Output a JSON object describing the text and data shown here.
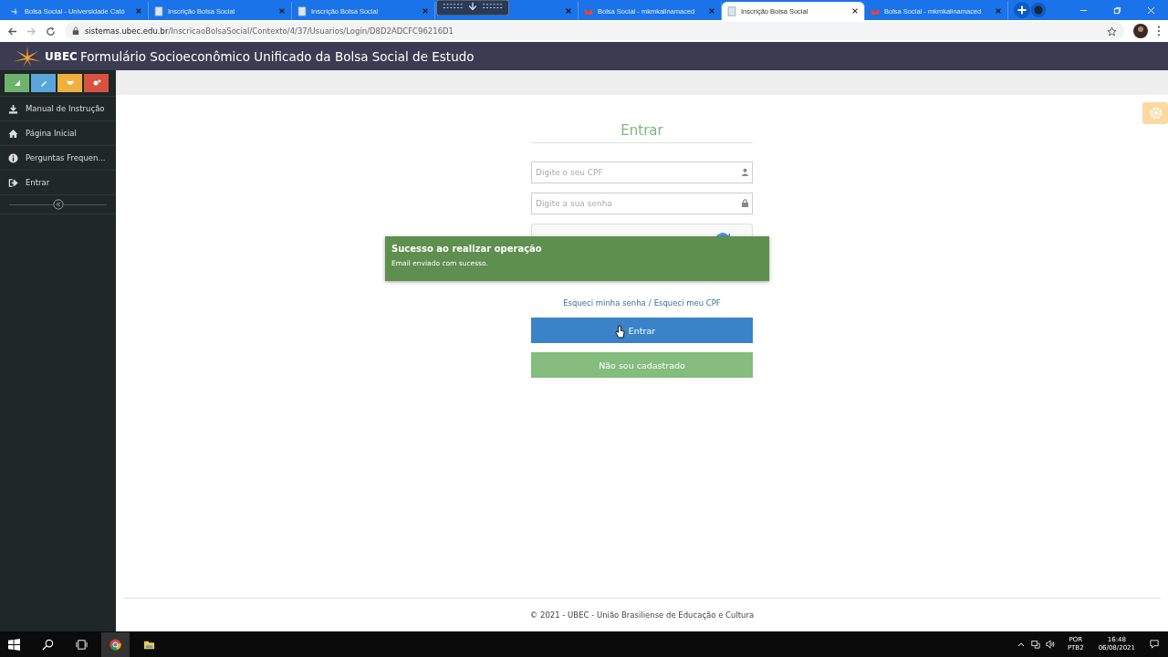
{
  "browser": {
    "tabs": [
      {
        "title": "Bolsa Social - Universidade Cató",
        "selected": false,
        "kind": "site"
      },
      {
        "title": "Inscrição Bolsa Social",
        "selected": false,
        "kind": "page"
      },
      {
        "title": "Inscrição Bolsa Social",
        "selected": false,
        "kind": "page"
      },
      {
        "kind": "hidden"
      },
      {
        "title": "Bolsa Social - mkmkalinamaced",
        "selected": false,
        "kind": "mail"
      },
      {
        "title": "Inscrição Bolsa Social",
        "selected": true,
        "kind": "page"
      },
      {
        "title": "Bolsa Social - mkmkalinamaced",
        "selected": false,
        "kind": "mail"
      }
    ],
    "url_host": "sistemas.ubec.edu.br",
    "url_path": "/InscricaoBolsaSocial/Contexto/4/37/Usuarios/Login/D8D2ADCFC96216D1"
  },
  "header": {
    "logo": "UBEC",
    "title": "Formulário Socioeconômico Unificado da Bolsa Social de Estudo"
  },
  "sidebar": {
    "shortcuts": [
      {
        "color": "#6db36d"
      },
      {
        "color": "#5aa6dc"
      },
      {
        "color": "#f0b040"
      },
      {
        "color": "#d8533f"
      }
    ],
    "items": [
      {
        "label": "Manual de Instrução"
      },
      {
        "label": "Página Inicial"
      },
      {
        "label": "Perguntas Frequen..."
      },
      {
        "label": "Entrar"
      }
    ]
  },
  "login": {
    "title": "Entrar",
    "cpf_placeholder": "Digite o seu CPF",
    "password_placeholder": "Digite a sua senha",
    "forgot_password": "Esqueci minha senha",
    "separator": "/",
    "forgot_cpf": "Esqueci meu CPF",
    "submit": "Entrar",
    "register": "Não sou cadastrado"
  },
  "toast": {
    "title": "Sucesso ao realizar operação",
    "message": "Email enviado com sucesso."
  },
  "footer": "© 2021 - UBEC - União Brasiliense de Educação e Cultura",
  "taskbar": {
    "language": "POR",
    "layout": "PTB2",
    "time": "16:48",
    "date": "06/08/2021"
  }
}
